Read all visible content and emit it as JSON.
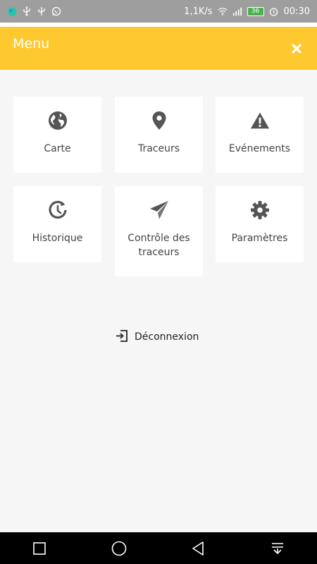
{
  "status_bar": {
    "speed": "1,1K/s",
    "battery": "36",
    "time": "00:30"
  },
  "header": {
    "title": "Menu"
  },
  "menu": {
    "items": [
      {
        "label": "Carte",
        "icon": "globe-icon"
      },
      {
        "label": "Traceurs",
        "icon": "map-pin-icon"
      },
      {
        "label": "Evénements",
        "icon": "warning-icon"
      },
      {
        "label": "Historique",
        "icon": "history-icon"
      },
      {
        "label": "Contrôle des traceurs",
        "icon": "paper-plane-icon"
      },
      {
        "label": "Paramètres",
        "icon": "gear-icon"
      }
    ]
  },
  "logout": {
    "label": "Déconnexion",
    "icon": "sign-out-icon"
  },
  "colors": {
    "header": "#fec92f",
    "background": "#f6f6f6",
    "icon": "#555555"
  }
}
